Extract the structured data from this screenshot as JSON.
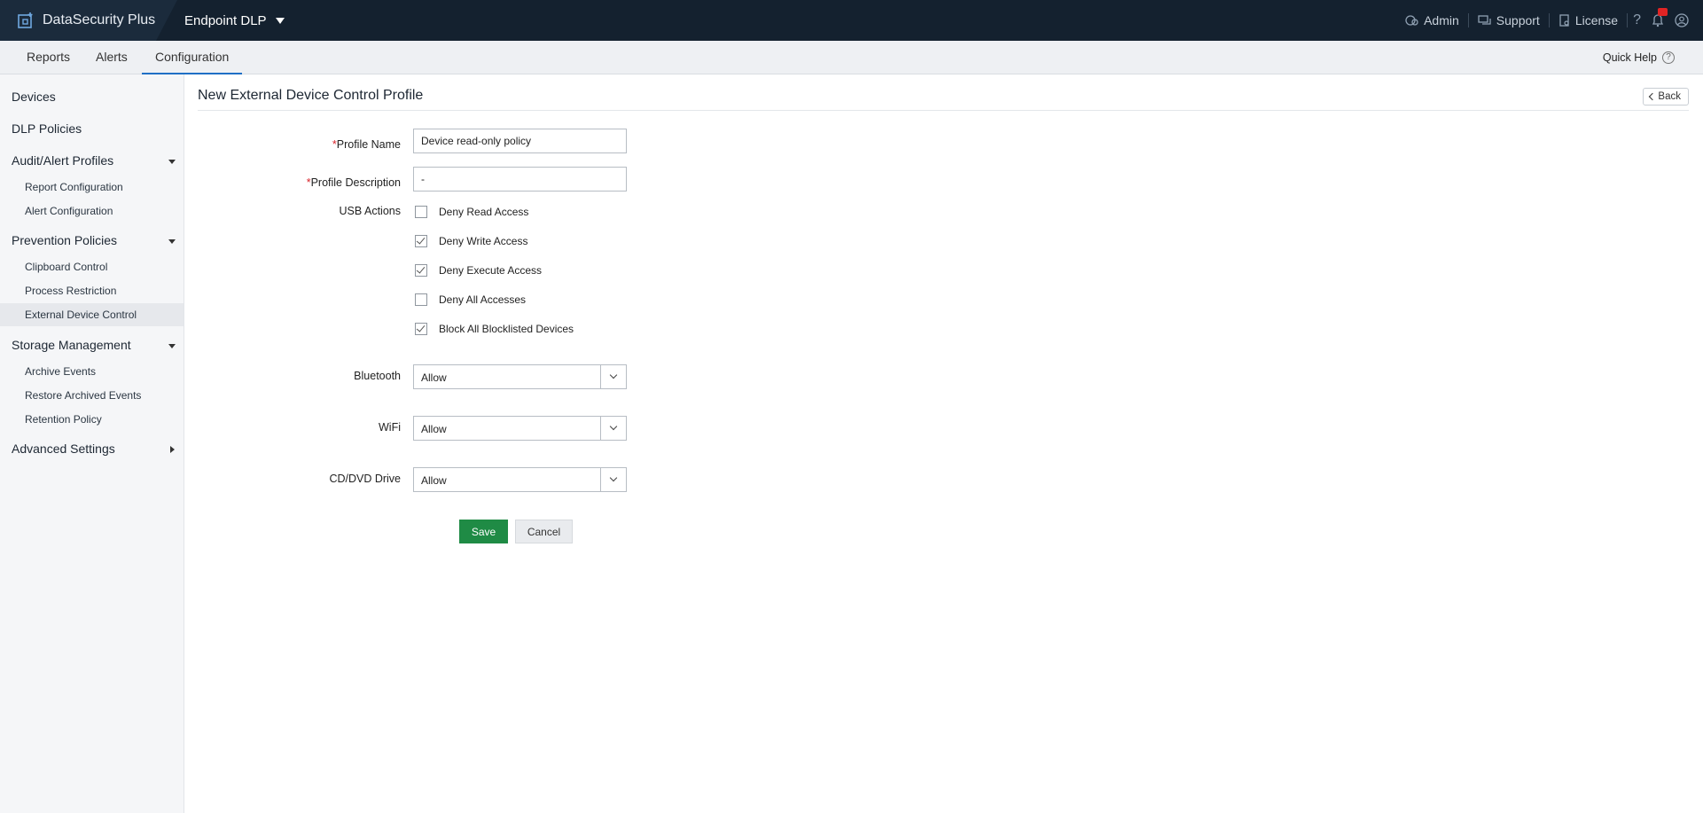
{
  "app": {
    "name": "DataSecurity Plus",
    "product": "Endpoint DLP"
  },
  "top_links": {
    "admin": "Admin",
    "support": "Support",
    "license": "License"
  },
  "tabs": [
    {
      "label": "Reports",
      "active": false
    },
    {
      "label": "Alerts",
      "active": false
    },
    {
      "label": "Configuration",
      "active": true
    }
  ],
  "quick_help": "Quick Help",
  "sidebar": {
    "devices": "Devices",
    "dlp_policies": "DLP Policies",
    "audit_alert_profiles": "Audit/Alert Profiles",
    "report_configuration": "Report Configuration",
    "alert_configuration": "Alert Configuration",
    "prevention_policies": "Prevention Policies",
    "clipboard_control": "Clipboard Control",
    "process_restriction": "Process Restriction",
    "external_device_control": "External Device Control",
    "storage_management": "Storage Management",
    "archive_events": "Archive Events",
    "restore_archived_events": "Restore Archived Events",
    "retention_policy": "Retention Policy",
    "advanced_settings": "Advanced Settings",
    "active_item": "External Device Control"
  },
  "page": {
    "title": "New External Device Control Profile",
    "back_label": "Back"
  },
  "form": {
    "profile_name_label": "Profile Name",
    "profile_name_value": "Device read-only policy",
    "profile_description_label": "Profile Description",
    "profile_description_value": "-",
    "usb_actions_label": "USB Actions",
    "usb_actions": [
      {
        "label": "Deny Read Access",
        "checked": false
      },
      {
        "label": "Deny Write Access",
        "checked": true
      },
      {
        "label": "Deny Execute Access",
        "checked": true
      },
      {
        "label": "Deny All Accesses",
        "checked": false
      },
      {
        "label": "Block All Blocklisted Devices",
        "checked": true
      }
    ],
    "bluetooth_label": "Bluetooth",
    "bluetooth_value": "Allow",
    "wifi_label": "WiFi",
    "wifi_value": "Allow",
    "cd_dvd_label": "CD/DVD Drive",
    "cd_dvd_value": "Allow",
    "required_marker": "*",
    "save_label": "Save",
    "cancel_label": "Cancel"
  },
  "colors": {
    "topbar": "#14212f",
    "accent": "#1f6fc5",
    "save": "#1f8b45",
    "required": "#d8232a"
  }
}
